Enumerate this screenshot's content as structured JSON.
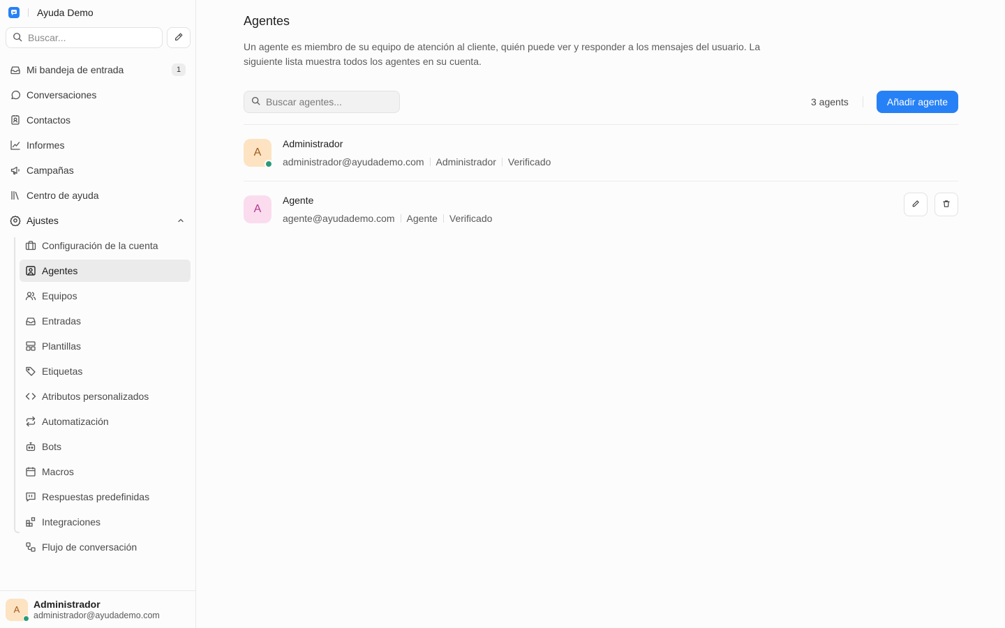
{
  "app": {
    "brand_name": "Ayuda Demo",
    "brand_color": "#2781f6"
  },
  "sidebar": {
    "search_placeholder": "Buscar...",
    "items": [
      {
        "label": "Mi bandeja de entrada",
        "icon": "inbox-icon",
        "badge": "1"
      },
      {
        "label": "Conversaciones",
        "icon": "chat-bubble-icon"
      },
      {
        "label": "Contactos",
        "icon": "contact-card-icon"
      },
      {
        "label": "Informes",
        "icon": "line-chart-icon"
      },
      {
        "label": "Campañas",
        "icon": "megaphone-icon"
      },
      {
        "label": "Centro de ayuda",
        "icon": "library-icon"
      },
      {
        "label": "Ajustes",
        "icon": "settings-icon",
        "expanded": true
      }
    ],
    "settings_items": [
      {
        "label": "Configuración de la cuenta",
        "icon": "briefcase-icon"
      },
      {
        "label": "Agentes",
        "icon": "user-square-icon",
        "active": true
      },
      {
        "label": "Equipos",
        "icon": "users-icon"
      },
      {
        "label": "Entradas",
        "icon": "inbox-icon"
      },
      {
        "label": "Plantillas",
        "icon": "layout-template-icon"
      },
      {
        "label": "Etiquetas",
        "icon": "tags-icon"
      },
      {
        "label": "Atributos personalizados",
        "icon": "code-icon"
      },
      {
        "label": "Automatización",
        "icon": "repeat-icon"
      },
      {
        "label": "Bots",
        "icon": "bot-icon"
      },
      {
        "label": "Macros",
        "icon": "calendar-icon"
      },
      {
        "label": "Respuestas predefinidas",
        "icon": "quote-message-icon"
      },
      {
        "label": "Integraciones",
        "icon": "blocks-icon"
      },
      {
        "label": "Flujo de conversación",
        "icon": "workflow-icon"
      }
    ],
    "profile": {
      "initial": "A",
      "name": "Administrador",
      "email": "administrador@ayudademo.com",
      "status_color": "#2a9a77"
    }
  },
  "main": {
    "title": "Agentes",
    "description": "Un agente es miembro de su equipo de atención al cliente, quién puede ver y responder a los mensajes del usuario. La siguiente lista muestra todos los agentes en su cuenta.",
    "search_placeholder": "Buscar agentes...",
    "count_label": "3 agents",
    "add_button": "Añadir agente",
    "agents": [
      {
        "initial": "A",
        "name": "Administrador",
        "email": "administrador@ayudademo.com",
        "role": "Administrador",
        "status": "Verificado",
        "avatar_bg": "#fde3c2",
        "avatar_fg": "#a05a1a",
        "online": true,
        "has_actions": false
      },
      {
        "initial": "A",
        "name": "Agente",
        "email": "agente@ayudademo.com",
        "role": "Agente",
        "status": "Verificado",
        "avatar_bg": "#fbdcef",
        "avatar_fg": "#b2388a",
        "online": false,
        "has_actions": true
      }
    ]
  }
}
